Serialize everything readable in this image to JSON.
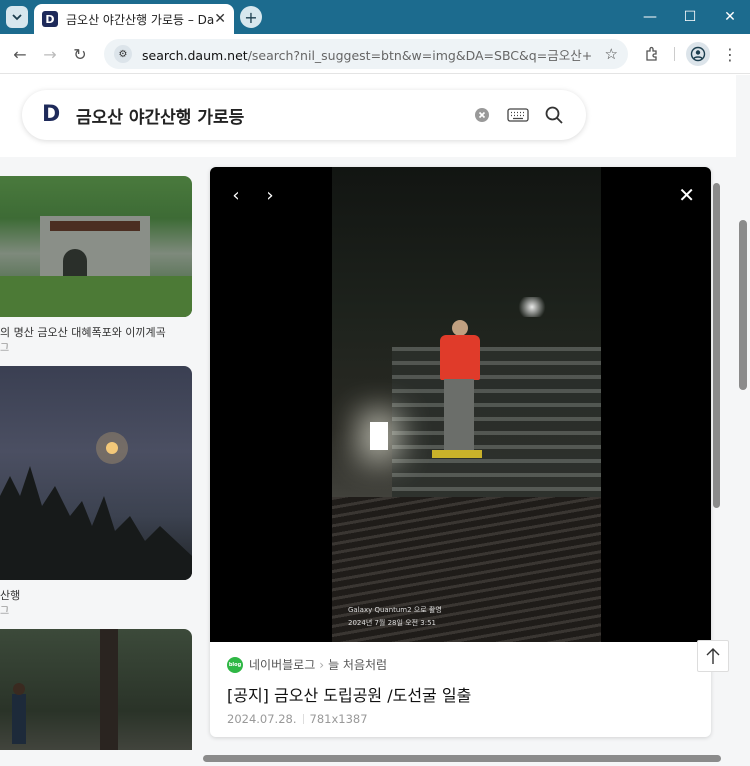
{
  "browser": {
    "tab_title": "금오산 야간산행 가로등 – Daum",
    "favicon_letter": "D",
    "url_domain": "search.daum.net",
    "url_rest": "/search?nil_suggest=btn&w=img&DA=SBC&q=금오산+야간산행..."
  },
  "search": {
    "query": "금오산 야간산행 가로등",
    "logo": "D"
  },
  "results": [
    {
      "caption": "의 명산 금오산 대혜폭포와 이끼계곡",
      "sub": "그"
    },
    {
      "caption": "산행",
      "sub": "그"
    }
  ],
  "viewer": {
    "photo_watermark_line1": "Galaxy Quantum2 으로 촬영",
    "photo_watermark_line2": "2024년 7월 28일 오전 3:51",
    "source_badge": "blog",
    "source_name": "네이버블로그",
    "source_author": "늘 처음처럼",
    "title": "[공지] 금오산 도립공원 /도선굴 일출",
    "date": "2024.07.28.",
    "dimensions": "781x1387"
  }
}
